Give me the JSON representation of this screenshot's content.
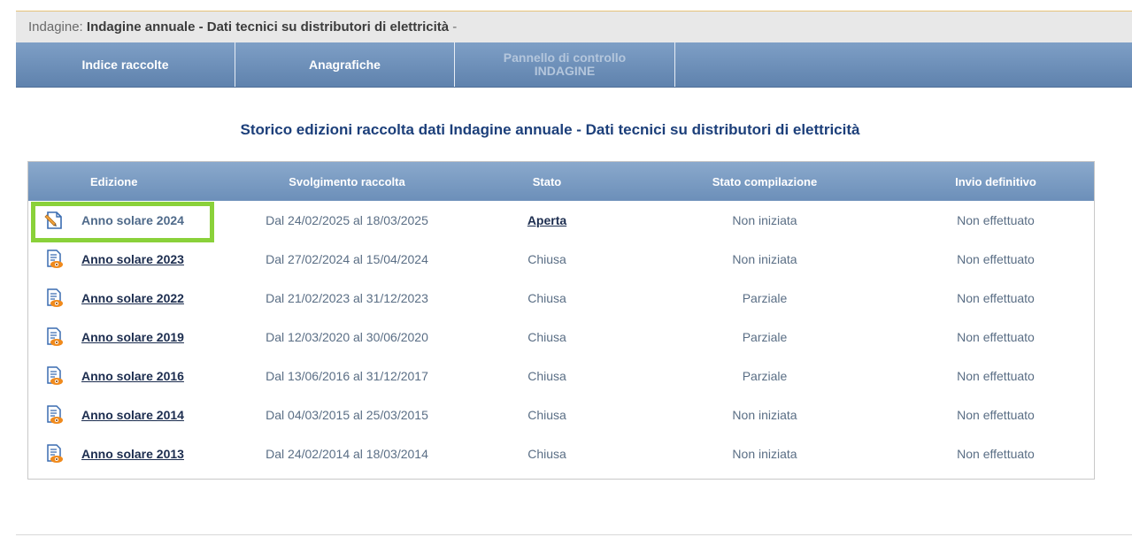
{
  "survey": {
    "label": "Indagine:",
    "title": "Indagine annuale - Dati tecnici su distributori di elettricità",
    "suffix": " -"
  },
  "nav": {
    "items": [
      {
        "label": "Indice raccolte",
        "active": true
      },
      {
        "label": "Anagrafiche",
        "active": true
      },
      {
        "label": "Pannello di controllo INDAGINE",
        "active": false
      }
    ]
  },
  "heading": "Storico edizioni raccolta dati Indagine annuale - Dati tecnici su distributori di elettricità",
  "table": {
    "headers": [
      "Edizione",
      "Svolgimento raccolta",
      "Stato",
      "Stato compilazione",
      "Invio definitivo"
    ],
    "rows": [
      {
        "icon": "edit-document-icon",
        "edizione": "Anno solare 2024",
        "svolgimento": "Dal 24/02/2025 al 18/03/2025",
        "stato": "Aperta",
        "compilazione": "Non iniziata",
        "invio": "Non effettuato"
      },
      {
        "icon": "view-document-icon",
        "edizione": "Anno solare 2023",
        "svolgimento": "Dal 27/02/2024 al 15/04/2024",
        "stato": "Chiusa",
        "compilazione": "Non iniziata",
        "invio": "Non effettuato"
      },
      {
        "icon": "view-document-icon",
        "edizione": "Anno solare 2022",
        "svolgimento": "Dal 21/02/2023 al 31/12/2023",
        "stato": "Chiusa",
        "compilazione": "Parziale",
        "invio": "Non effettuato"
      },
      {
        "icon": "view-document-icon",
        "edizione": "Anno solare 2019",
        "svolgimento": "Dal 12/03/2020 al 30/06/2020",
        "stato": "Chiusa",
        "compilazione": "Parziale",
        "invio": "Non effettuato"
      },
      {
        "icon": "view-document-icon",
        "edizione": "Anno solare 2016",
        "svolgimento": "Dal 13/06/2016 al 31/12/2017",
        "stato": "Chiusa",
        "compilazione": "Parziale",
        "invio": "Non effettuato"
      },
      {
        "icon": "view-document-icon",
        "edizione": "Anno solare 2014",
        "svolgimento": "Dal 04/03/2015 al 25/03/2015",
        "stato": "Chiusa",
        "compilazione": "Non iniziata",
        "invio": "Non effettuato"
      },
      {
        "icon": "view-document-icon",
        "edizione": "Anno solare 2013",
        "svolgimento": "Dal 24/02/2014 al 18/03/2014",
        "stato": "Chiusa",
        "compilazione": "Non iniziata",
        "invio": "Non effettuato"
      }
    ]
  },
  "colors": {
    "nav_bg": "#6c8fb9",
    "heading": "#1c3f7a",
    "highlight": "#8ad13a"
  }
}
